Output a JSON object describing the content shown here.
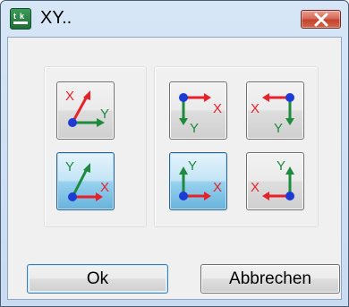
{
  "window": {
    "title": "XY..",
    "app_icon": "xy-app-icon",
    "close_icon": "close-x-icon"
  },
  "orientations": [
    {
      "id": "tl",
      "label_a": "X",
      "label_b": "Y",
      "selected": false
    },
    {
      "id": "bl",
      "label_a": "Y",
      "label_b": "X",
      "selected": true
    },
    {
      "id": "tr1",
      "label_a": "X",
      "label_b": "Y",
      "selected": false
    },
    {
      "id": "tr2",
      "label_a": "X",
      "label_b": "Y",
      "selected": false
    },
    {
      "id": "br1",
      "label_a": "Y",
      "label_b": "X",
      "selected": true
    },
    {
      "id": "br2",
      "label_a": "Y",
      "label_b": "X",
      "selected": false
    }
  ],
  "colors": {
    "x_axis": "#e8202a",
    "y_axis": "#1e8a3c",
    "origin": "#1f3bd6",
    "selected_fill": "#98d1ef"
  },
  "buttons": {
    "ok_label": "Ok",
    "cancel_label": "Abbrechen"
  }
}
